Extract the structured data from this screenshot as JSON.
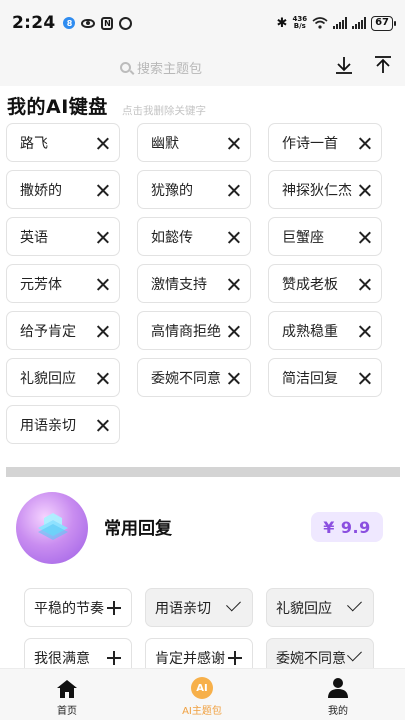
{
  "status_bar": {
    "time": "2:24",
    "badge": "8",
    "network_speed": "436\nB/s",
    "battery": "67"
  },
  "search": {
    "placeholder": "搜索主题包"
  },
  "my_keyboard": {
    "title": "我的AI键盘",
    "hint": "点击我删除关键字",
    "chips": [
      "路飞",
      "幽默",
      "作诗一首",
      "撒娇的",
      "犹豫的",
      "神探狄仁杰",
      "英语",
      "如懿传",
      "巨蟹座",
      "元芳体",
      "激情支持",
      "赞成老板",
      "给予肯定",
      "高情商拒绝",
      "成熟稳重",
      "礼貌回应",
      "委婉不同意",
      "简洁回复",
      "用语亲切"
    ]
  },
  "pack": {
    "name": "常用回复",
    "price": "¥ 9.9",
    "chips": [
      {
        "label": "平稳的节奏",
        "state": "add"
      },
      {
        "label": "用语亲切",
        "state": "added"
      },
      {
        "label": "礼貌回应",
        "state": "added"
      },
      {
        "label": "我很满意",
        "state": "add"
      },
      {
        "label": "肯定并感谢",
        "state": "add"
      },
      {
        "label": "委婉不同意",
        "state": "added"
      }
    ]
  },
  "tabs": [
    {
      "label": "首页",
      "icon": "home-icon",
      "active": false
    },
    {
      "label": "AI主题包",
      "icon": "ai-theme-icon",
      "active": true
    },
    {
      "label": "我的",
      "icon": "profile-icon",
      "active": false
    }
  ],
  "colors": {
    "accent": "#8b4fe0",
    "price_bg": "#efe8ff",
    "tab_active": "#f0a040"
  }
}
